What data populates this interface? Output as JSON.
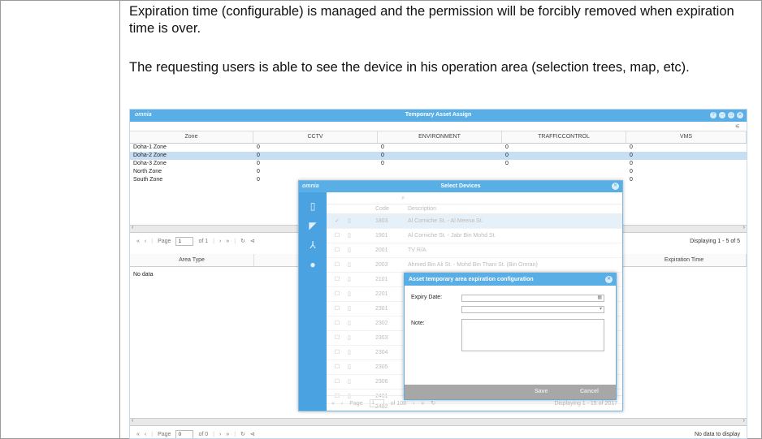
{
  "paragraphs": [
    "Expiration time (configurable) is managed and the permission will be forcibly removed when expiration time is over.",
    "The requesting users is able to see the device in his operation area (selection trees, map, etc)."
  ],
  "app": {
    "logo": "omnia",
    "title": "Temporary Asset Assign",
    "columns": [
      "Zone",
      "CCTV",
      "ENVIRONMENT",
      "TRAFFICCONTROL",
      "VMS"
    ],
    "rows": [
      {
        "zone": "Doha-1 Zone",
        "cctv": "0",
        "env": "0",
        "traffic": "0",
        "vms": "0"
      },
      {
        "zone": "Doha-2 Zone",
        "cctv": "0",
        "env": "0",
        "traffic": "0",
        "vms": "0"
      },
      {
        "zone": "Doha-3 Zone",
        "cctv": "0",
        "env": "0",
        "traffic": "0",
        "vms": "0"
      },
      {
        "zone": "North Zone",
        "cctv": "0",
        "env": "",
        "traffic": "",
        "vms": "0"
      },
      {
        "zone": "South Zone",
        "cctv": "0",
        "env": "",
        "traffic": "",
        "vms": "0"
      }
    ],
    "pager1": {
      "page_label": "Page",
      "page": "1",
      "of": "of 1",
      "display": "Displaying 1 - 5 of 5"
    },
    "grid2_columns": [
      "Area Type",
      "Expiration Time"
    ],
    "grid2_nodata": "No data",
    "pager2": {
      "page_label": "Page",
      "page": "0",
      "of": "of 0",
      "display": "No data to display"
    }
  },
  "select_devices": {
    "logo": "omnia",
    "title": "Select Devices",
    "col_code": "Code",
    "col_desc": "Description",
    "devices": [
      {
        "code": "1803",
        "desc": "Al Corniche St. - Al Meena St."
      },
      {
        "code": "1901",
        "desc": "Al Corniche St. - Jabr Bin Mohd St."
      },
      {
        "code": "2001",
        "desc": "TV R/A"
      },
      {
        "code": "2003",
        "desc": "Ahmed Bin Ali St. - Mohd Bin Thani St. (Bin Omran)"
      },
      {
        "code": "2101",
        "desc": ""
      },
      {
        "code": "2201",
        "desc": ""
      },
      {
        "code": "2301",
        "desc": ""
      },
      {
        "code": "2302",
        "desc": ""
      },
      {
        "code": "2303",
        "desc": ""
      },
      {
        "code": "2304",
        "desc": ""
      },
      {
        "code": "2305",
        "desc": ""
      },
      {
        "code": "2306",
        "desc": ""
      },
      {
        "code": "2401",
        "desc": ""
      },
      {
        "code": "2402",
        "desc": ""
      }
    ],
    "pager": {
      "page_label": "Page",
      "page": "1",
      "of": "of 108",
      "display": "Displaying 1 - 15 of 2017"
    }
  },
  "dialog": {
    "title": "Asset temporary area expiration configuration",
    "expiry_label": "Expiry Date:",
    "note_label": "Note:",
    "save": "Save",
    "cancel": "Cancel"
  }
}
